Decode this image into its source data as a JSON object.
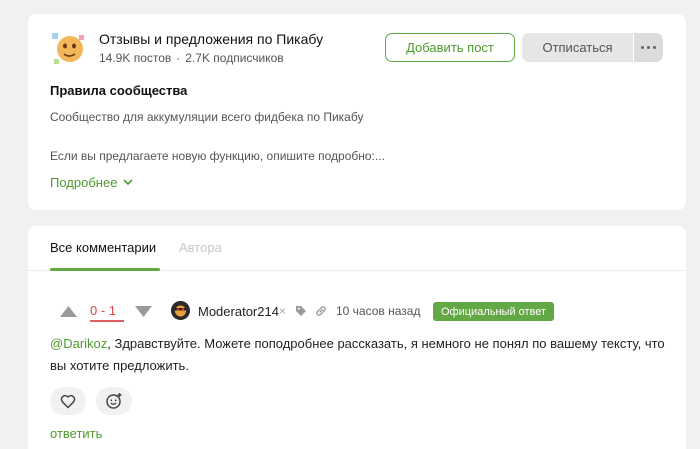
{
  "community": {
    "title": "Отзывы и предложения по Пикабу",
    "posts": "14.9K постов",
    "separator": "·",
    "subscribers": "2.7K подписчиков",
    "add_post_label": "Добавить пост",
    "unsubscribe_label": "Отписаться",
    "rules_title": "Правила сообщества",
    "rules_description": "Сообщество для аккумуляции всего фидбека по Пикабу",
    "rules_note": "Если вы предлагаете новую функцию, опишите подробно:...",
    "more_label": "Подробнее"
  },
  "comments": {
    "tabs": [
      {
        "label": "Все комментарии",
        "active": true
      },
      {
        "label": "Автора",
        "active": false
      }
    ],
    "items": [
      {
        "rating": "0 - 1",
        "username": "Moderator214",
        "mod_mark": "×",
        "time": "10 часов назад",
        "badge": "Официальный ответ",
        "mention": "@Darikoz",
        "text": ", Здравствуйте. Можете поподробнее рассказать, я немного не понял по вашему тексту, что вы хотите предложить.",
        "reply_label": "ответить"
      }
    ]
  },
  "colors": {
    "accent": "#62a844",
    "rating_negative": "#d84646",
    "background": "#f1f1f1"
  }
}
